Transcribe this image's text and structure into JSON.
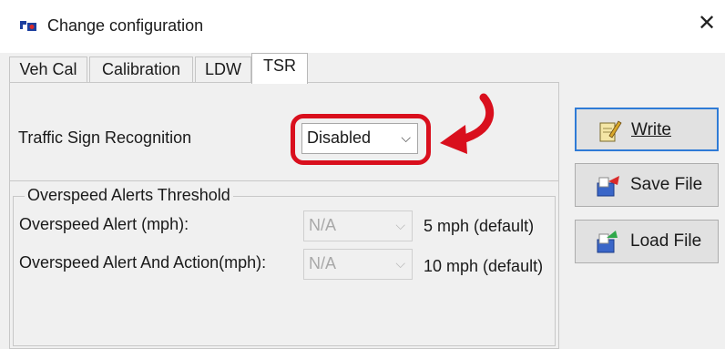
{
  "window": {
    "title": "Change configuration",
    "close_glyph": "✕"
  },
  "tabs": [
    {
      "label": "Veh Cal",
      "active": false
    },
    {
      "label": "Calibration",
      "active": false
    },
    {
      "label": "LDW",
      "active": false
    },
    {
      "label": "TSR",
      "active": true
    }
  ],
  "tsr": {
    "label": "Traffic Sign Recognition",
    "value": "Disabled",
    "highlight_color": "#d90f1d"
  },
  "overspeed": {
    "legend": "Overspeed Alerts Threshold",
    "rows": [
      {
        "label": "Overspeed Alert (mph):",
        "value": "N/A",
        "default": "5 mph (default)"
      },
      {
        "label": "Overspeed Alert And Action(mph):",
        "value": "N/A",
        "default": "10 mph (default)"
      }
    ]
  },
  "buttons": {
    "write": {
      "label": "Write",
      "icon": "notepad-write-icon"
    },
    "save": {
      "label": "Save File",
      "icon": "save-file-icon"
    },
    "load": {
      "label": "Load File",
      "icon": "load-file-icon"
    }
  },
  "colors": {
    "accent": "#2f7bd6",
    "window_bg": "#f0f0f0"
  }
}
